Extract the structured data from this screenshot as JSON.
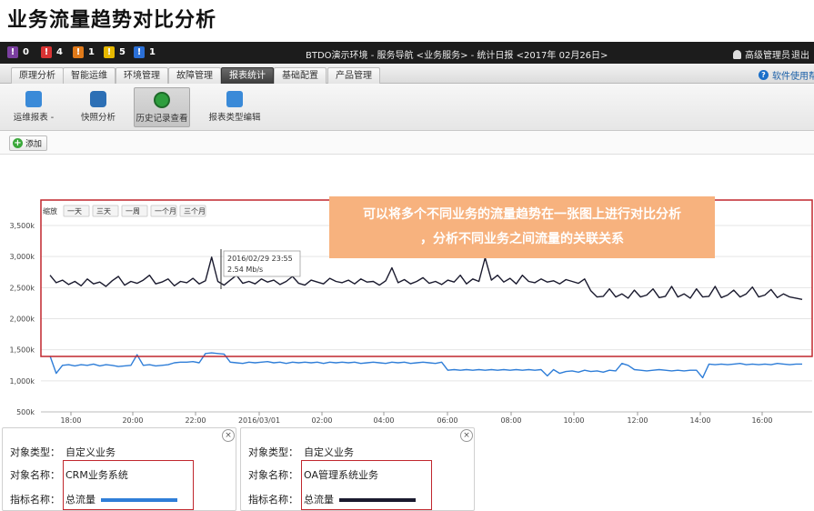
{
  "page_title": "业务流量趋势对比分析",
  "topbar": {
    "alarms": [
      {
        "color": "#7b3fa0",
        "count": "0"
      },
      {
        "color": "#d93434",
        "count": "4"
      },
      {
        "color": "#e07a1a",
        "count": "1"
      },
      {
        "color": "#e6b800",
        "count": "5"
      },
      {
        "color": "#2a6fd6",
        "count": "1"
      }
    ],
    "breadcrumb": "BTDO演示环境 - 服务导航 <业务服务> - 统计日报 <2017年 02月26日>",
    "user": "高级管理员",
    "logout": "退出"
  },
  "tabs": [
    {
      "label": "原理分析",
      "active": false
    },
    {
      "label": "智能运维",
      "active": false
    },
    {
      "label": "环境管理",
      "active": false
    },
    {
      "label": "故障管理",
      "active": false
    },
    {
      "label": "报表统计",
      "active": true
    },
    {
      "label": "基础配置",
      "active": false
    },
    {
      "label": "产品管理",
      "active": false
    }
  ],
  "help": "软件使用帮助",
  "ribbon": [
    {
      "label": "运维报表 -",
      "icon": "report-icon",
      "color": "#3a8ad8"
    },
    {
      "label": "快照分析",
      "icon": "camera-icon",
      "color": "#2c6fb5"
    },
    {
      "label": "历史记录查看",
      "icon": "clock-icon",
      "color": "#2e9e3e"
    },
    {
      "label": "报表类型编辑",
      "icon": "edit-report-icon",
      "color": "#3a8ad8"
    }
  ],
  "toolbar": {
    "add_label": "添加"
  },
  "chart_controls": {
    "zoom_label": "缩放",
    "ranges": [
      "一天",
      "三天",
      "一周",
      "一个月",
      "三个月"
    ]
  },
  "tooltip": {
    "time": "2016/02/29 23:55",
    "value": "2.54 Mb/s"
  },
  "callout": {
    "line1": "可以将多个不同业务的流量趋势在一张图上进行对比分析",
    "line2": "，分析不同业务之间流量的关联关系"
  },
  "navigator_year": "2016",
  "chart_data": {
    "type": "line",
    "title": "",
    "xlabel": "",
    "ylabel": "",
    "ylim": [
      500,
      3500
    ],
    "y_ticks": [
      "3,500k",
      "3,000k",
      "2,500k",
      "2,000k",
      "1,500k",
      "1,000k",
      "500k"
    ],
    "x_ticks": [
      "18:00",
      "20:00",
      "22:00",
      "2016/03/01",
      "02:00",
      "04:00",
      "06:00",
      "08:00",
      "10:00",
      "12:00",
      "14:00",
      "16:00"
    ],
    "series": [
      {
        "name": "OA管理系统业务",
        "color": "#1a1a2e",
        "values": [
          2700,
          2580,
          2620,
          2550,
          2600,
          2530,
          2640,
          2560,
          2590,
          2520,
          2610,
          2680,
          2540,
          2600,
          2570,
          2620,
          2700,
          2560,
          2590,
          2640,
          2530,
          2600,
          2580,
          2650,
          2560,
          2610,
          2990,
          2600,
          2540,
          2620,
          2700,
          2570,
          2600,
          2560,
          2640,
          2590,
          2620,
          2550,
          2600,
          2680,
          2570,
          2540,
          2620,
          2590,
          2560,
          2650,
          2600,
          2580,
          2620,
          2560,
          2640,
          2590,
          2600,
          2540,
          2610,
          2820,
          2580,
          2630,
          2560,
          2600,
          2660,
          2570,
          2600,
          2550,
          2620,
          2590,
          2700,
          2560,
          2640,
          2600,
          2980,
          2620,
          2700,
          2590,
          2650,
          2560,
          2700,
          2600,
          2580,
          2640,
          2590,
          2610,
          2560,
          2630,
          2600,
          2570,
          2640,
          2450,
          2350,
          2360,
          2480,
          2350,
          2400,
          2330,
          2460,
          2350,
          2380,
          2480,
          2340,
          2360,
          2520,
          2350,
          2400,
          2330,
          2480,
          2350,
          2360,
          2520,
          2340,
          2380,
          2460,
          2350,
          2400,
          2510,
          2350,
          2380,
          2470,
          2340,
          2400,
          2350,
          2330,
          2310
        ]
      },
      {
        "name": "CRM业务系统",
        "color": "#2f7ed8",
        "values": [
          1400,
          1120,
          1250,
          1260,
          1240,
          1260,
          1250,
          1270,
          1240,
          1260,
          1250,
          1230,
          1240,
          1250,
          1420,
          1250,
          1260,
          1240,
          1250,
          1260,
          1290,
          1300,
          1300,
          1310,
          1290,
          1440,
          1450,
          1440,
          1430,
          1300,
          1290,
          1280,
          1300,
          1290,
          1300,
          1310,
          1290,
          1300,
          1280,
          1300,
          1290,
          1300,
          1290,
          1300,
          1280,
          1300,
          1290,
          1300,
          1290,
          1300,
          1280,
          1290,
          1300,
          1290,
          1280,
          1300,
          1290,
          1300,
          1280,
          1290,
          1300,
          1290,
          1280,
          1300,
          1170,
          1180,
          1170,
          1180,
          1170,
          1180,
          1170,
          1180,
          1170,
          1180,
          1170,
          1180,
          1170,
          1180,
          1170,
          1180,
          1080,
          1180,
          1120,
          1150,
          1160,
          1140,
          1170,
          1150,
          1160,
          1140,
          1170,
          1160,
          1280,
          1250,
          1180,
          1170,
          1160,
          1170,
          1180,
          1170,
          1160,
          1170,
          1160,
          1170,
          1170,
          1050,
          1270,
          1260,
          1270,
          1260,
          1270,
          1280,
          1260,
          1270,
          1260,
          1270,
          1260,
          1280,
          1270,
          1260,
          1270,
          1270
        ]
      }
    ]
  },
  "legend_cards": [
    {
      "type_key": "对象类型：",
      "type_val": "自定义业务",
      "name_key": "对象名称：",
      "name_val": "CRM业务系统",
      "metric_key": "指标名称：",
      "metric_val": "总流量",
      "swatch": "#2f7ed8"
    },
    {
      "type_key": "对象类型：",
      "type_val": "自定义业务",
      "name_key": "对象名称：",
      "name_val": "OA管理系统业务",
      "metric_key": "指标名称：",
      "metric_val": "总流量",
      "swatch": "#1a1a2e"
    }
  ]
}
